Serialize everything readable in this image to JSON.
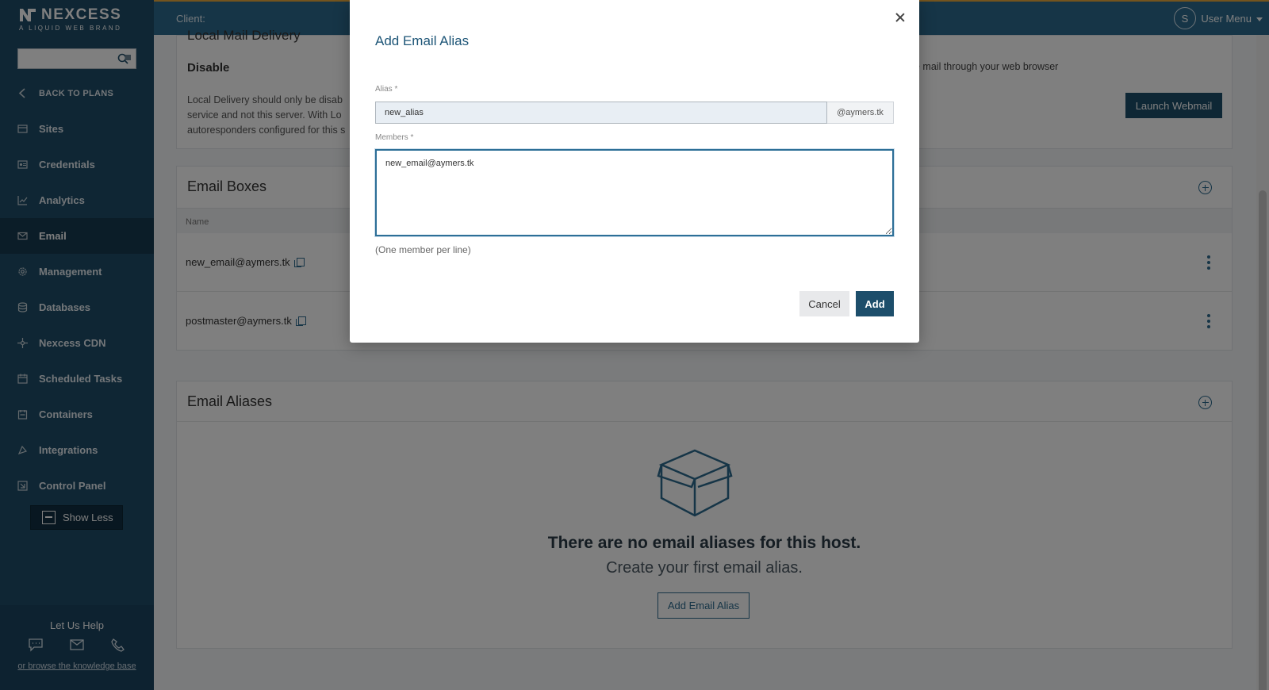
{
  "brand": {
    "name": "NEXCESS",
    "tagline": "A LIQUID WEB BRAND"
  },
  "sidebar": {
    "back_label": "BACK TO PLANS",
    "items": [
      {
        "label": "Sites",
        "icon": "sites-icon"
      },
      {
        "label": "Credentials",
        "icon": "credentials-icon"
      },
      {
        "label": "Analytics",
        "icon": "analytics-icon"
      },
      {
        "label": "Email",
        "icon": "email-icon",
        "active": true
      },
      {
        "label": "Management",
        "icon": "gear-icon"
      },
      {
        "label": "Databases",
        "icon": "database-icon"
      },
      {
        "label": "Nexcess CDN",
        "icon": "cdn-icon"
      },
      {
        "label": "Scheduled Tasks",
        "icon": "calendar-icon"
      },
      {
        "label": "Containers",
        "icon": "container-icon"
      },
      {
        "label": "Integrations",
        "icon": "integrations-icon"
      },
      {
        "label": "Control Panel",
        "icon": "control-panel-icon"
      }
    ],
    "show_less_label": "Show Less",
    "help": {
      "title": "Let Us Help",
      "link": "or browse the knowledge base"
    }
  },
  "topbar": {
    "client_label": "Client:",
    "avatar_letter": "S",
    "user_menu": "User Menu"
  },
  "main": {
    "local_delivery": {
      "title": "Local Mail Delivery",
      "state": "Disable",
      "description": "Local Delivery should only be disab service and not this server. With Lo autoresponders configured for this s",
      "webmail_note": "e mail through your web browser",
      "launch_button": "Launch Webmail"
    },
    "email_boxes": {
      "title": "Email Boxes",
      "column_name": "Name",
      "rows": [
        {
          "email": "new_email@aymers.tk"
        },
        {
          "email": "postmaster@aymers.tk"
        }
      ]
    },
    "email_aliases": {
      "title": "Email Aliases",
      "empty_title": "There are no email aliases for this host.",
      "empty_subtitle": "Create your first email alias.",
      "add_button": "Add Email Alias"
    }
  },
  "modal": {
    "title": "Add Email Alias",
    "alias_label": "Alias *",
    "alias_value": "new_alias",
    "alias_suffix": "@aymers.tk",
    "members_label": "Members *",
    "members_value": "new_email@aymers.tk",
    "hint": "(One member per line)",
    "cancel": "Cancel",
    "add": "Add"
  },
  "colors": {
    "sidebar": "#1f4d68",
    "topbar": "#2c6a8e",
    "primary": "#1d4e6b",
    "accent_line": "#e9a93c"
  }
}
